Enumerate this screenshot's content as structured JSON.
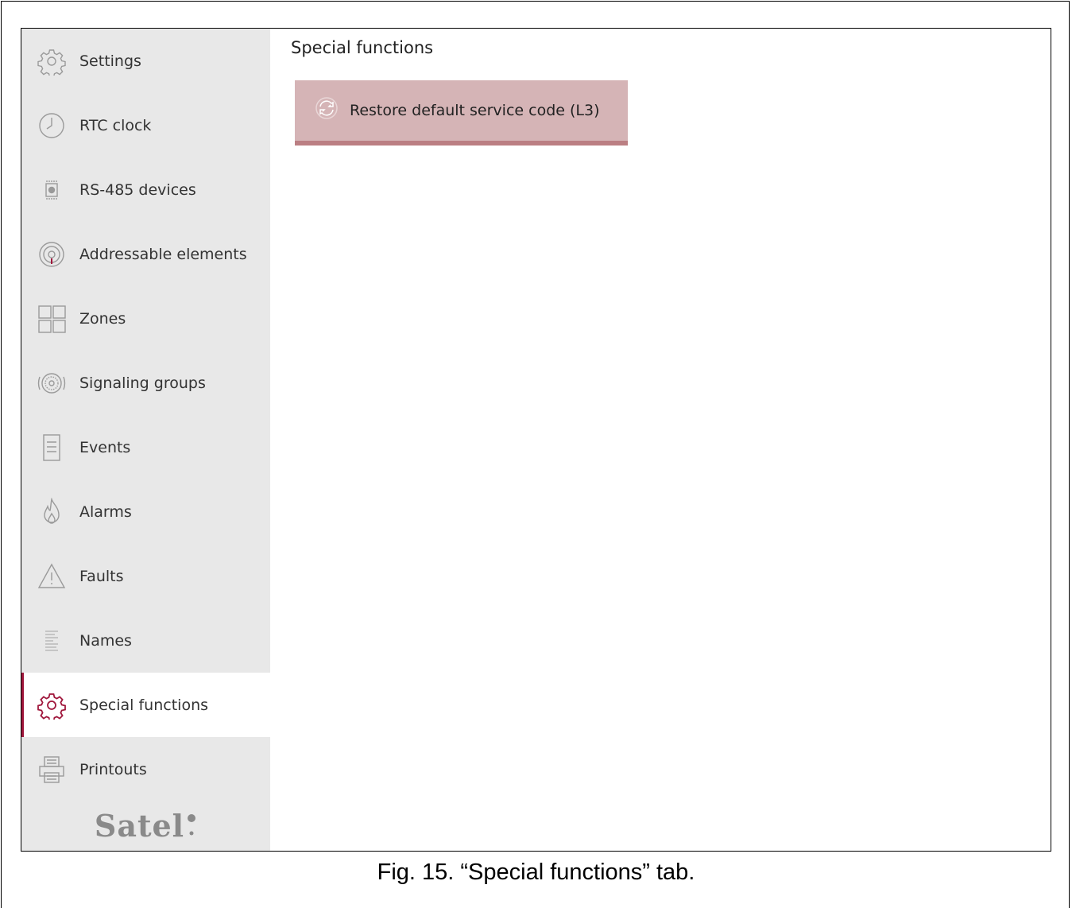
{
  "sidebar": {
    "items": [
      {
        "label": "Settings",
        "icon": "gear-icon"
      },
      {
        "label": "RTC clock",
        "icon": "clock-icon"
      },
      {
        "label": "RS-485 devices",
        "icon": "device-icon"
      },
      {
        "label": "Addressable elements",
        "icon": "detector-icon"
      },
      {
        "label": "Zones",
        "icon": "zones-icon"
      },
      {
        "label": "Signaling groups",
        "icon": "signaling-icon"
      },
      {
        "label": "Events",
        "icon": "document-icon"
      },
      {
        "label": "Alarms",
        "icon": "flame-icon"
      },
      {
        "label": "Faults",
        "icon": "warning-icon"
      },
      {
        "label": "Names",
        "icon": "list-icon"
      },
      {
        "label": "Special functions",
        "icon": "gear-icon",
        "active": true
      },
      {
        "label": "Printouts",
        "icon": "printer-icon"
      }
    ],
    "logo": "Satel"
  },
  "content": {
    "title": "Special functions",
    "restore_button_label": "Restore default service code (L3)"
  },
  "caption": "Fig. 15. “Special functions” tab.",
  "colors": {
    "accent": "#a0173c",
    "sidebar_bg": "#e8e8e8",
    "button_bg": "#d5b4b6",
    "button_border": "#bb7f83"
  }
}
